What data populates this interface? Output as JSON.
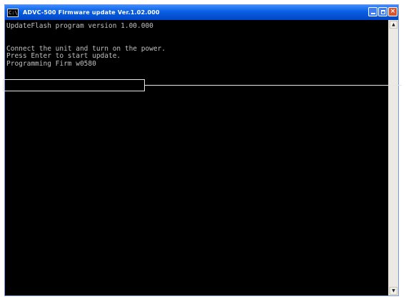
{
  "window": {
    "title": "ADVC-500 Firmware update Ver.1.02.000",
    "icon_text": "C:\\",
    "controls": {
      "minimize_icon": "minimize-icon",
      "maximize_icon": "maximize-icon",
      "close_icon": "close-icon",
      "close_glyph": "×"
    }
  },
  "console": {
    "lines": [
      "UpdateFlash program version 1.00.000",
      "",
      "",
      "Connect the unit and turn on the power.",
      "Press Enter to start update.",
      "Programming Firm w0580"
    ]
  },
  "scrollbar": {
    "up_glyph": "▲",
    "down_glyph": "▼"
  },
  "colors": {
    "console_bg": "#000000",
    "console_text": "#c0c0c0",
    "titlebar": "#0a5fe0",
    "callout": "#e6e6e6"
  }
}
